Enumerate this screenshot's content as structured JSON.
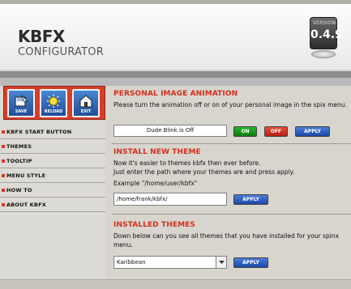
{
  "header": {
    "brand": "KBFX",
    "subtitle": "CONFIGURATOR",
    "version_label": "VERSION",
    "version": "0.4.9"
  },
  "toolbar": {
    "buttons": [
      {
        "label": "SAVE",
        "icon": "save-icon"
      },
      {
        "label": "RELOAD",
        "icon": "reload-icon"
      },
      {
        "label": "EXIT",
        "icon": "exit-icon"
      }
    ]
  },
  "sidebar": {
    "items": [
      {
        "label": "KBFX START BUTTON"
      },
      {
        "label": "THEMES"
      },
      {
        "label": "TOOLTIP"
      },
      {
        "label": "MENU STYLE"
      },
      {
        "label": "HOW TO"
      },
      {
        "label": "ABOUT KBFX"
      }
    ]
  },
  "panels": {
    "personal": {
      "title": "PERSONAL IMAGE ANIMATION",
      "text": "Please turn the animation off or on of your personal image in the spix menu.",
      "status": "Dude Blink is Off",
      "on_label": "ON",
      "off_label": "OFF",
      "apply_label": "APPLY"
    },
    "install": {
      "title": "INSTALL NEW THEME",
      "text_line1": "Now it's easier to themes kbfx then ever before.",
      "text_line2": "Just enter the path where your themes are and press apply.",
      "example": "Example \"/home/user/kbfx\"",
      "path_value": "/home/frank/kbfx/",
      "apply_label": "APPLY"
    },
    "installed": {
      "title": "INSTALLED THEMES",
      "text": "Down below can you see all themes that you have installed for your spinx menu.",
      "selected_theme": "Karibbean",
      "apply_label": "APPLY"
    }
  },
  "colors": {
    "accent_red": "#d42f1c",
    "apply_blue": "#1c49a8",
    "on_green": "#0c7c13"
  }
}
